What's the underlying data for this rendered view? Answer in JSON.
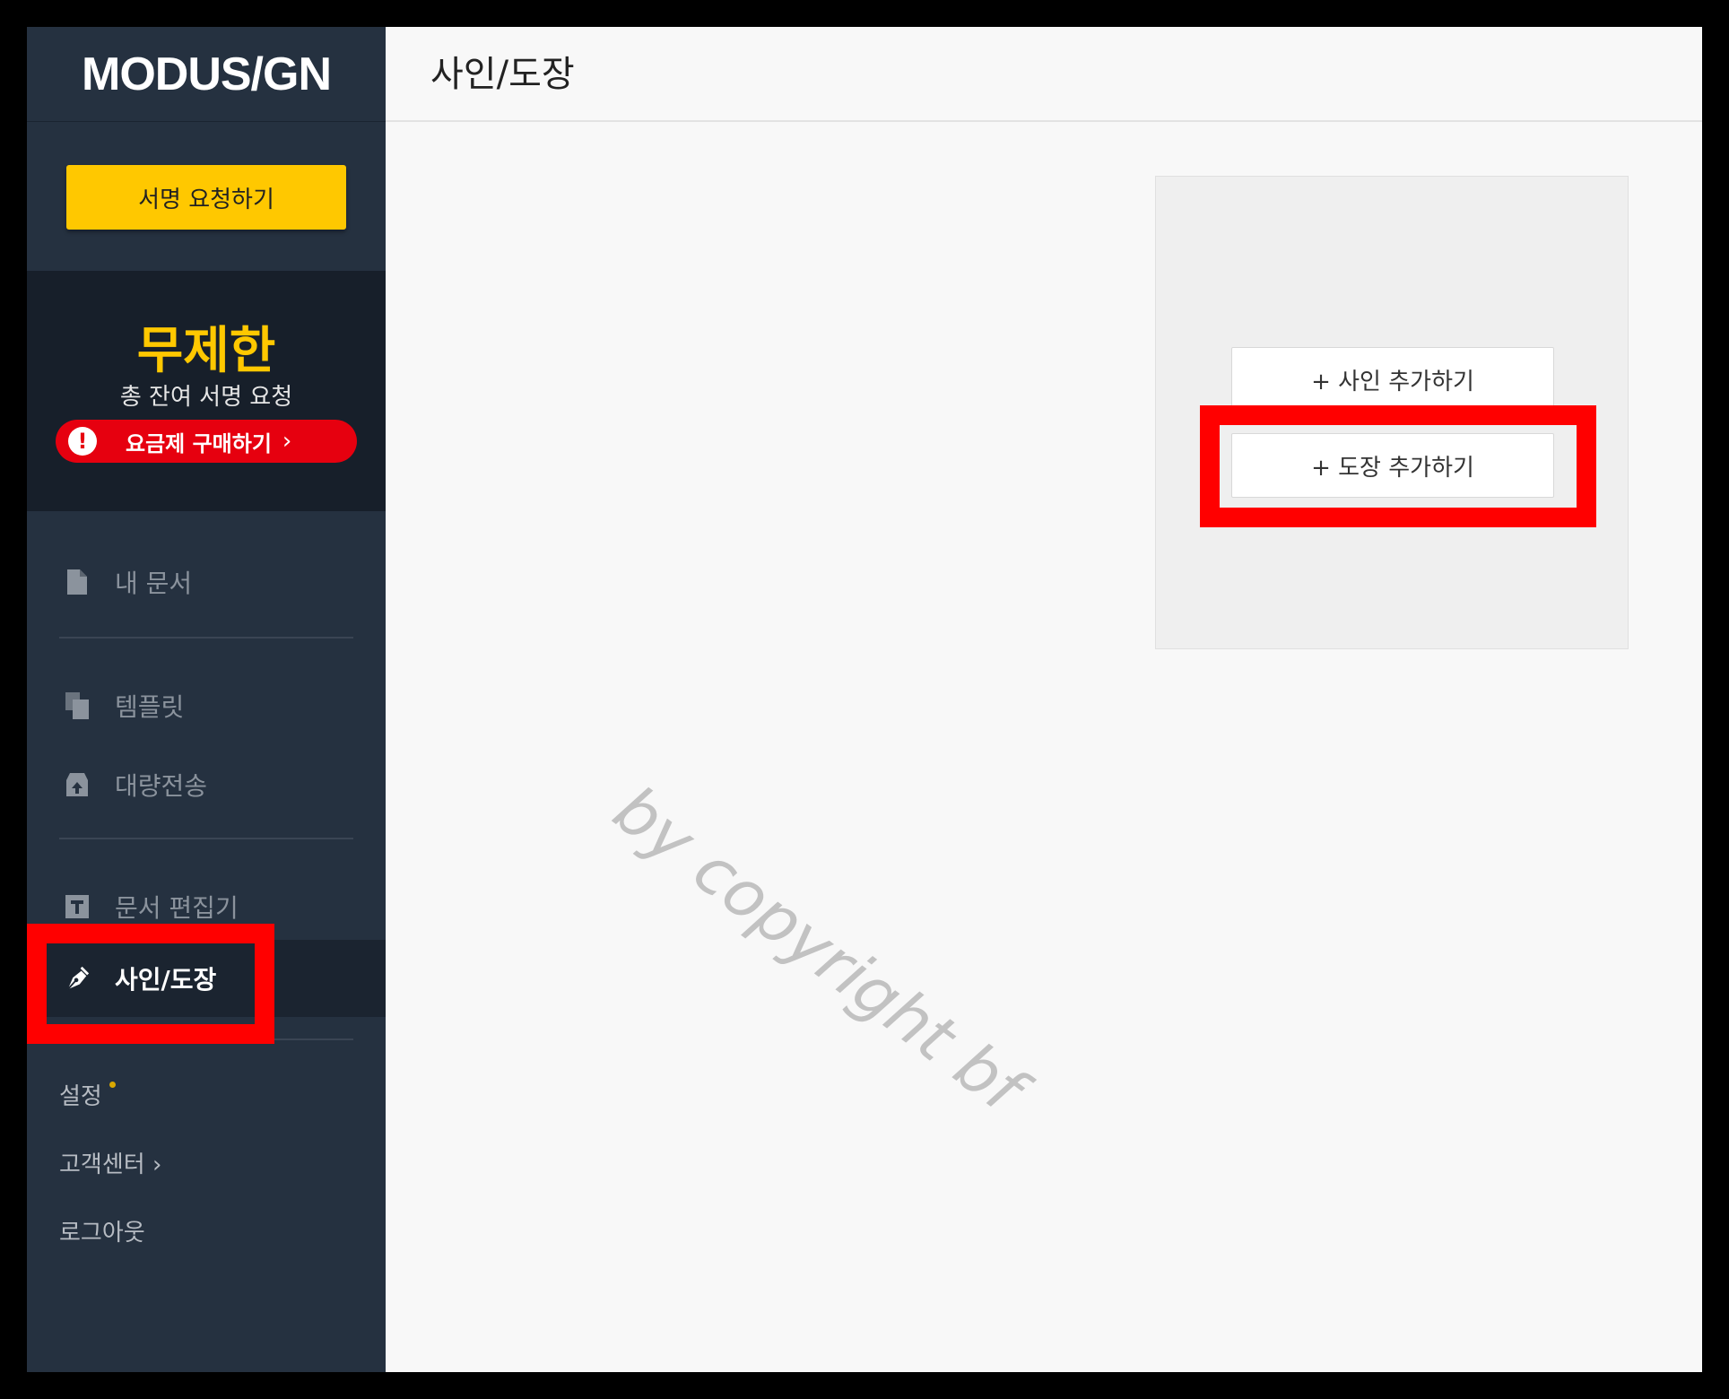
{
  "app": {
    "logo": "MODUS/GN"
  },
  "sidebar": {
    "request_button": "서명 요청하기",
    "plan": {
      "title": "무제한",
      "subtitle": "총 잔여 서명 요청",
      "buy_label": "요금제 구매하기",
      "buy_chevron": "›",
      "alert_icon": "!"
    },
    "nav": [
      {
        "label": "내 문서",
        "icon": "document-icon"
      },
      {
        "label": "템플릿",
        "icon": "template-icon"
      },
      {
        "label": "대량전송",
        "icon": "bulk-send-icon"
      },
      {
        "label": "문서 편집기",
        "icon": "text-editor-icon"
      },
      {
        "label": "사인/도장",
        "icon": "pen-nib-icon",
        "active": true
      }
    ],
    "footer": {
      "settings": "설정",
      "support": "고객센터 ›",
      "logout": "로그아웃"
    }
  },
  "main": {
    "title": "사인/도장",
    "add_signature": "+ 사인 추가하기",
    "add_stamp": "+ 도장 추가하기"
  },
  "watermark": "by copyright bf",
  "colors": {
    "sidebar_bg": "#253140",
    "accent_yellow": "#ffc800",
    "alert_red": "#e6000f",
    "highlight_red": "#ff0000"
  }
}
